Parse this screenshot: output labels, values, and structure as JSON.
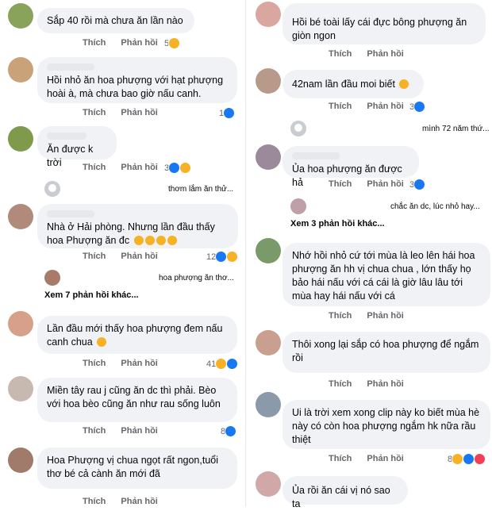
{
  "left": [
    {
      "text": "Sắp 40 rồi mà chưa ăn lần nào",
      "like": "Thích",
      "reply": "Phản hồi",
      "count": "5",
      "avatar_color": "#8aa35a"
    },
    {
      "text": "Hồi nhỏ ăn hoa phượng với hạt phượng hoài à, mà chưa bao giờ nấu canh.",
      "like": "Thích",
      "reply": "Phản hồi",
      "count": "1",
      "avatar_color": "#c9a27a"
    },
    {
      "text": "Ăn được k trời",
      "like": "Thích",
      "reply": "Phản hồi",
      "count": "3",
      "avatar_color": "#7f9a4a",
      "reply_preview": "thơm lắm ăn thử..."
    },
    {
      "text": "Nhà ở Hải phòng. Nhưng lần đầu thấy hoa Phượng ăn đc",
      "like": "Thích",
      "reply": "Phản hồi",
      "count": "12",
      "avatar_color": "#b08a7a",
      "reply_preview": "hoa phượng ăn thơ...",
      "more_replies": "Xem 7 phản hồi khác..."
    },
    {
      "text": "Lần đầu mới thấy hoa phượng đem nấu canh chua",
      "like": "Thích",
      "reply": "Phản hồi",
      "count": "41",
      "avatar_color": "#d7a08a"
    },
    {
      "text": "Miền tây rau j cũng ăn dc thì phải. Bèo với hoa bèo cũng ăn như rau sống luôn",
      "like": "Thích",
      "reply": "Phản hồi",
      "count": "8",
      "avatar_color": "#c7b8b0"
    },
    {
      "text": "Hoa Phượng vị chua ngọt rất ngon,tuổi thơ bé cả cành ăn mới đã",
      "like": "Thích",
      "reply": "Phản hồi",
      "count": "",
      "avatar_color": "#a07a6a"
    }
  ],
  "right": [
    {
      "text": "Hồi bé toài lấy cái đực bông phượng ăn giòn ngon",
      "like": "Thích",
      "reply": "Phản hồi",
      "count": "",
      "avatar_color": "#d9a6a0"
    },
    {
      "text": "42nam lần đầu moi biết",
      "like": "Thích",
      "reply": "Phản hồi",
      "count": "3",
      "avatar_color": "#b89a8a",
      "reply_preview": "mình 72 năm thứ..."
    },
    {
      "text": "Ủa hoa phượng ăn được hả",
      "like": "Thích",
      "reply": "Phản hồi",
      "count": "3",
      "avatar_color": "#9a8a9a",
      "reply_preview": "chắc ăn dc, lúc nhỏ hay...",
      "more_replies": "Xem 3 phản hồi khác..."
    },
    {
      "text": "Nhớ hồi nhỏ cứ tới mùa là leo lên hái hoa phượng ăn hh vị chua chua , lớn thấy họ bảo hái nấu với cá cái là giờ lâu lâu tới mùa hay hái nấu với cá",
      "like": "Thích",
      "reply": "Phản hồi",
      "count": "",
      "avatar_color": "#7a9a6a"
    },
    {
      "text": "Thôi xong lại sắp có hoa phượng để ngắm rồi",
      "like": "Thích",
      "reply": "Phản hồi",
      "count": "",
      "avatar_color": "#c9a090"
    },
    {
      "text": "Ui là trời xem xong clip này ko biết mùa hè này có còn hoa phượng ngắm hk nữa rầu thiệt",
      "like": "Thích",
      "reply": "Phản hồi",
      "count": "8",
      "avatar_color": "#8a9aaa"
    },
    {
      "text": "Ủa rồi ăn cái vị nó sao ta",
      "like": "Thích",
      "reply": "Phản hồi",
      "count": "",
      "avatar_color": "#d0a8a8"
    }
  ]
}
